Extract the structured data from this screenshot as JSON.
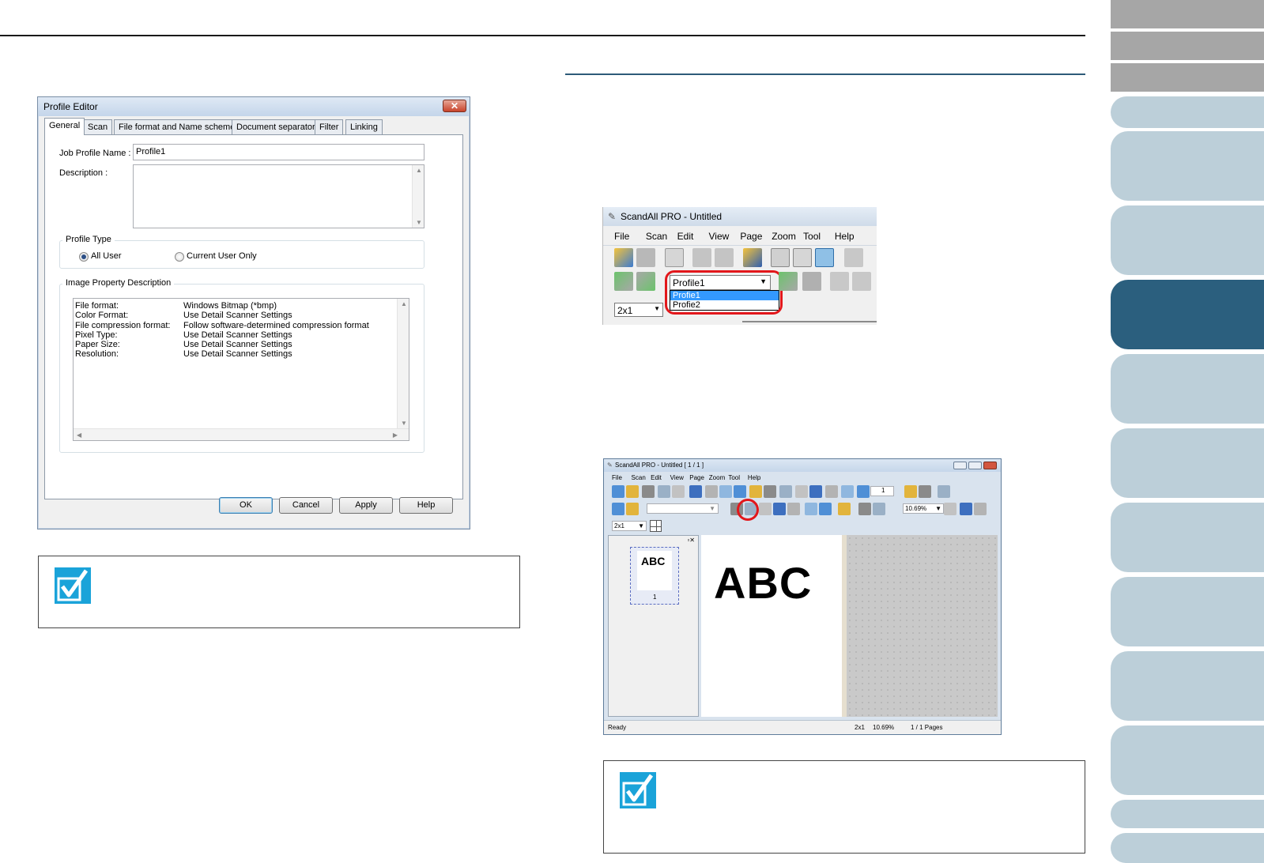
{
  "dialog": {
    "title": "Profile Editor",
    "close_symbol": "✕",
    "tabs": [
      "General",
      "Scan",
      "File format and Name scheme",
      "Document separator",
      "Filter",
      "Linking"
    ],
    "job_profile_label": "Job Profile Name :",
    "job_profile_value": "Profile1",
    "description_label": "Description :",
    "profile_type_label": "Profile Type",
    "radio_all_user": "All User",
    "radio_current_user": "Current User Only",
    "image_property_label": "Image Property Description",
    "properties": [
      {
        "key": "File format:",
        "value": "Windows Bitmap (*bmp)"
      },
      {
        "key": "Color Format:",
        "value": "Use Detail Scanner Settings"
      },
      {
        "key": "File compression format:",
        "value": "Follow software-determined compression format"
      },
      {
        "key": "Pixel Type:",
        "value": "Use Detail Scanner Settings"
      },
      {
        "key": "Paper Size:",
        "value": "Use Detail Scanner Settings"
      },
      {
        "key": "Resolution:",
        "value": "Use Detail Scanner Settings"
      }
    ],
    "buttons": {
      "ok": "OK",
      "cancel": "Cancel",
      "apply": "Apply",
      "help": "Help"
    }
  },
  "scandall_crop": {
    "title": "ScandAll PRO - Untitled",
    "menu": [
      "File",
      "Scan",
      "Edit",
      "View",
      "Page",
      "Zoom",
      "Tool",
      "Help"
    ],
    "profile_selected": "Profile1",
    "dropdown_options": [
      "Profie1",
      "Profie2"
    ],
    "layout_value": "2x1"
  },
  "scandall_window": {
    "title": "ScandAll PRO - Untitled [ 1 / 1 ]",
    "menu": [
      "File",
      "Scan",
      "Edit",
      "View",
      "Page",
      "Zoom",
      "Tool",
      "Help"
    ],
    "page_number": "1",
    "zoom_value": "10.69%",
    "layout_value": "2x1",
    "thumb_text": "ABC",
    "thumb_page": "1",
    "document_text": "ABC",
    "status_ready": "Ready",
    "status_layout": "2x1",
    "status_zoom": "10.69%",
    "status_pages": "1 / 1 Pages"
  },
  "colors": {
    "accent_blue": "#2b5f7e",
    "tab_blue": "#bccfd9",
    "tab_gray": "#a6a6a6",
    "check_blue": "#1aa3d9",
    "highlight_red": "#e2171b"
  }
}
